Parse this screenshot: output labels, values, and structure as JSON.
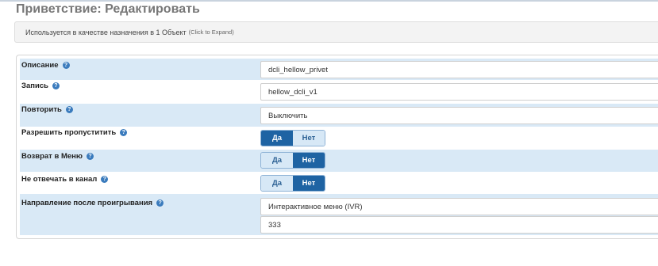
{
  "page": {
    "title": "Приветствие: Редактировать",
    "info_text": "Используется в качестве назначения в 1 Объект",
    "info_expand": "(Click to Expand)"
  },
  "fields": {
    "description": {
      "label": "Описание",
      "value": "dcli_hellow_privet"
    },
    "recording": {
      "label": "Запись",
      "value": "hellow_dcli_v1"
    },
    "repeat": {
      "label": "Повторить",
      "value": "Выключить"
    },
    "allow_skip": {
      "label": "Разрешить пропуститить",
      "yes": "Да",
      "no": "Нет",
      "selected": "Да"
    },
    "return_to_menu": {
      "label": "Возврат в Меню",
      "yes": "Да",
      "no": "Нет",
      "selected": "Нет"
    },
    "no_answer": {
      "label": "Не отвечать в канал",
      "yes": "Да",
      "no": "Нет",
      "selected": "Нет"
    },
    "destination": {
      "label": "Направление после проигрывания",
      "type_value": "Интерактивное меню (IVR)",
      "target_value": "333"
    }
  },
  "icons": {
    "help": "help-icon",
    "help_glyph": "?"
  },
  "colors": {
    "row_highlight": "#d9e9f6",
    "toggle_active": "#1e63a3",
    "toggle_inactive": "#d7e8f6",
    "help_icon": "#3a7bbd"
  }
}
